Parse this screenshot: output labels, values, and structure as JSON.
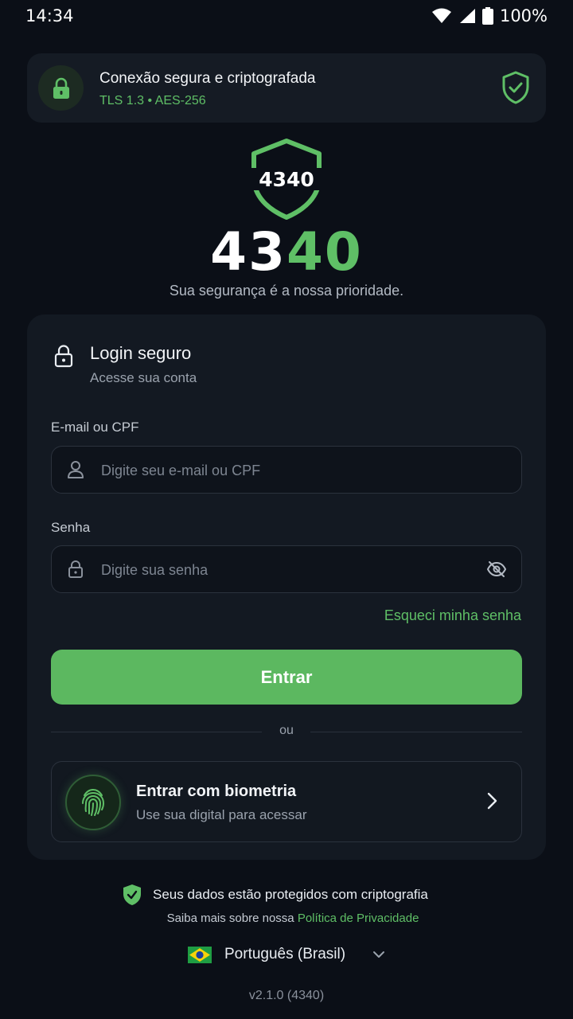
{
  "status_bar": {
    "time": "14:34",
    "battery": "100%"
  },
  "secure_banner": {
    "title": "Conexão segura e criptografada",
    "subtitle": "TLS 1.3 • AES-256"
  },
  "brand": {
    "shield_text": "4340",
    "logo_part1": "43",
    "logo_part2": "40",
    "tagline": "Sua segurança é a nossa prioridade."
  },
  "login_card": {
    "title": "Login seguro",
    "subtitle": "Acesse sua conta",
    "email_label": "E-mail ou CPF",
    "email_placeholder": "Digite seu e-mail ou CPF",
    "email_value": "",
    "password_label": "Senha",
    "password_placeholder": "Digite sua senha",
    "password_value": "",
    "forgot_link": "Esqueci minha senha",
    "submit_label": "Entrar",
    "divider_text": "ou",
    "biometric_title": "Entrar com biometria",
    "biometric_subtitle": "Use sua digital para acessar"
  },
  "footer": {
    "protection_text": "Seus dados estão protegidos com criptografia",
    "privacy_prefix": "Saiba mais sobre nossa ",
    "privacy_link": "Política de Privacidade",
    "language": "Português (Brasil)",
    "version": "v2.1.0 (4340)"
  },
  "colors": {
    "background": "#0b0f17",
    "card": "#131922",
    "accent": "#5fbf66",
    "button": "#5cb860"
  }
}
